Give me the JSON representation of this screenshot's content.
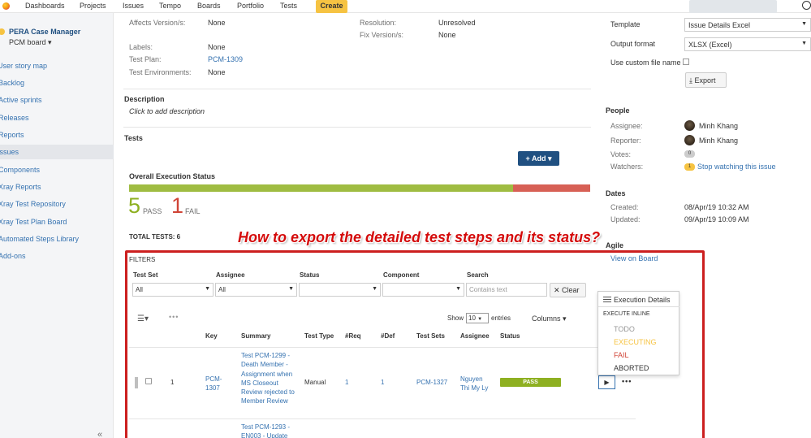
{
  "nav": {
    "items": [
      "Dashboards",
      "Projects",
      "Issues",
      "Tempo",
      "Boards",
      "Portfolio",
      "Tests"
    ],
    "create_label": "Create"
  },
  "sidebar": {
    "project_name": "PERA Case Manager",
    "board_label": "PCM board ▾",
    "items": [
      "User story map",
      "Backlog",
      "Active sprints",
      "Releases",
      "Reports",
      "Issues",
      "Components",
      "Xray Reports",
      "Xray Test Repository",
      "Xray Test Plan Board",
      "Automated Steps Library",
      "Add-ons"
    ],
    "collapse_label": "«"
  },
  "details": {
    "affects_label": "Affects Version/s:",
    "affects_value": "None",
    "labels_label": "Labels:",
    "labels_value": "None",
    "test_plan_label": "Test Plan:",
    "test_plan_value": "PCM-1309",
    "test_env_label": "Test Environments:",
    "test_env_value": "None",
    "resolution_label": "Resolution:",
    "resolution_value": "Unresolved",
    "fix_label": "Fix Version/s:",
    "fix_value": "None"
  },
  "description": {
    "heading": "Description",
    "placeholder": "Click to add description"
  },
  "tests": {
    "heading": "Tests",
    "add_label": "+ Add ▾",
    "overall_label": "Overall Execution Status",
    "pass_count": "5",
    "pass_label": "PASS",
    "fail_count": "1",
    "fail_label": "FAIL",
    "total_label": "TOTAL TESTS: 6",
    "pass_fraction": 0.833
  },
  "annotation": {
    "question": "How to export the detailed test steps and its status?"
  },
  "filters": {
    "heading": "FILTERS",
    "test_set_label": "Test Set",
    "test_set_value": "All",
    "assignee_label": "Assignee",
    "assignee_value": "All",
    "status_label": "Status",
    "status_value": "",
    "component_label": "Component",
    "component_value": "",
    "search_label": "Search",
    "search_placeholder": "Contains text",
    "clear_label": "✕ Clear"
  },
  "table": {
    "show_label": "Show",
    "show_value": "10",
    "entries_label": "entries",
    "columns_label": "Columns ▾",
    "headers": [
      "Key",
      "Summary",
      "Test Type",
      "#Req",
      "#Def",
      "Test Sets",
      "Assignee",
      "Status"
    ],
    "rows": [
      {
        "rank": "1",
        "key": "PCM-1307",
        "summary": "Test PCM-1299 - Death Member - Assignment when MS Closeout Review rejected to Member Review",
        "type": "Manual",
        "req": "1",
        "def": "1",
        "sets": "PCM-1327",
        "assignee": "Nguyen Thi My Ly",
        "status": "PASS"
      },
      {
        "summary": "Test PCM-1293 - EN003 - Update"
      }
    ]
  },
  "exec_menu": {
    "title": "Execution Details",
    "header": "EXECUTE INLINE",
    "items": [
      "TODO",
      "EXECUTING",
      "FAIL",
      "ABORTED"
    ],
    "colors": [
      "#999999",
      "#f6c342",
      "#d04437",
      "#333333"
    ]
  },
  "right": {
    "template_label": "Template",
    "template_value": "Issue Details Excel",
    "format_label": "Output format",
    "format_value": "XLSX (Excel)",
    "custom_label": "Use custom file name",
    "export_label": "Export",
    "people_heading": "People",
    "assignee_label": "Assignee:",
    "assignee_value": "Minh Khang",
    "reporter_label": "Reporter:",
    "reporter_value": "Minh Khang",
    "votes_label": "Votes:",
    "votes_value": "0",
    "watchers_label": "Watchers:",
    "watchers_count": "1",
    "watchers_link": "Stop watching this issue",
    "dates_heading": "Dates",
    "created_label": "Created:",
    "created_value": "08/Apr/19 10:32 AM",
    "updated_label": "Updated:",
    "updated_value": "09/Apr/19 10:09 AM",
    "agile_heading": "Agile",
    "agile_link": "View on Board"
  },
  "colors": {
    "pass": "#8eb021",
    "fail": "#d04437",
    "link": "#3572b0",
    "annotation": "#d40b0b"
  }
}
